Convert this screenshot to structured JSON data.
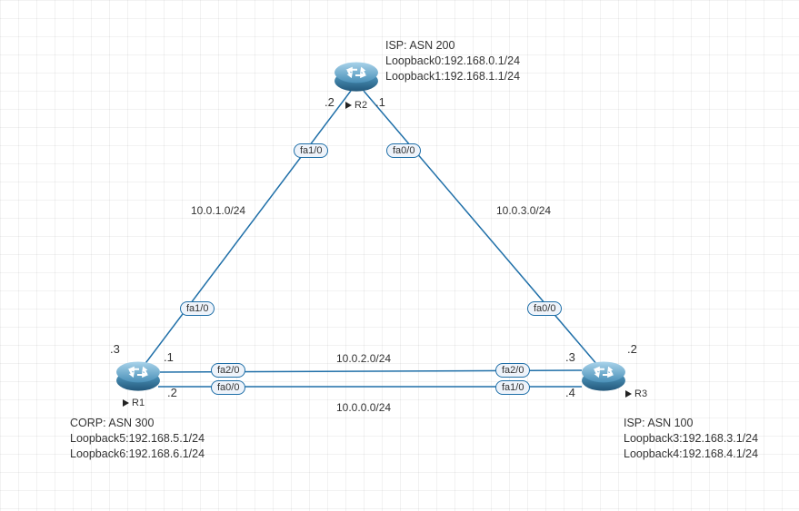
{
  "routers": {
    "r2": {
      "name": "R2",
      "title_line1": "ISP: ASN 200",
      "title_line2": "Loopback0:192.168.0.1/24",
      "title_line3": "Loopback1:192.168.1.1/24",
      "host_left": ".2",
      "host_right": ".1",
      "if_left": "fa1/0",
      "if_right": "fa0/0"
    },
    "r1": {
      "name": "R1",
      "title_line1": "CORP: ASN 300",
      "title_line2": "Loopback5:192.168.5.1/24",
      "title_line3": "Loopback6:192.168.6.1/24",
      "host_up": ".3",
      "host_topright": ".1",
      "host_botright": ".2",
      "if_up": "fa1/0",
      "if_top": "fa2/0",
      "if_bot": "fa0/0"
    },
    "r3": {
      "name": "R3",
      "title_line1": "ISP: ASN 100",
      "title_line2": "Loopback3:192.168.3.1/24",
      "title_line3": "Loopback4:192.168.4.1/24",
      "host_up": ".2",
      "host_topleft": ".3",
      "host_botleft": ".4",
      "if_up": "fa0/0",
      "if_top": "fa2/0",
      "if_bot": "fa1/0"
    }
  },
  "links": {
    "l12": "10.0.1.0/24",
    "l23": "10.0.3.0/24",
    "l13_top": "10.0.2.0/24",
    "l13_bot": "10.0.0.0/24"
  }
}
